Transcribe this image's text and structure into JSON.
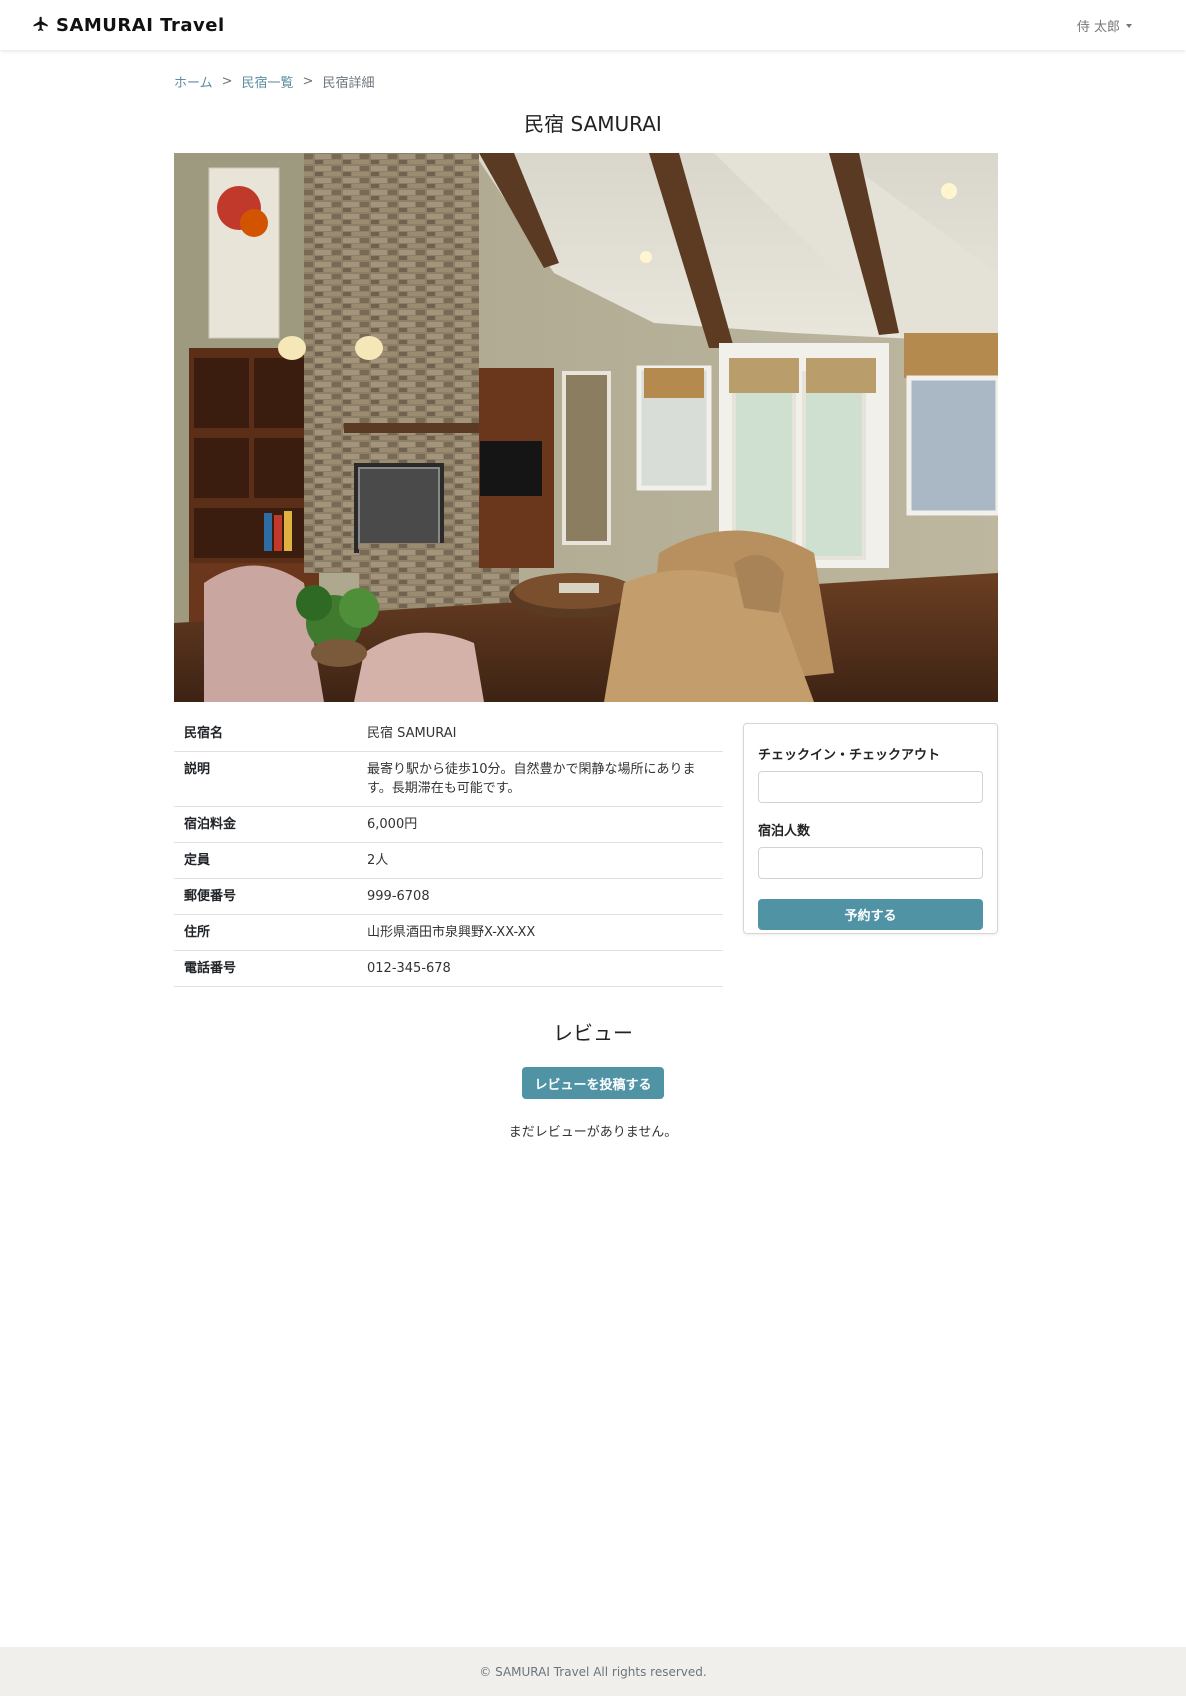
{
  "header": {
    "brand": "SAMURAI Travel",
    "user_name": "侍 太郎"
  },
  "breadcrumb": {
    "home": "ホーム",
    "list": "民宿一覧",
    "current": "民宿詳細",
    "separator": ">"
  },
  "inn": {
    "title": "民宿 SAMURAI",
    "photo_alt": "living room"
  },
  "details": [
    {
      "label": "民宿名",
      "value": "民宿 SAMURAI"
    },
    {
      "label": "説明",
      "value": "最寄り駅から徒歩10分。自然豊かで閑静な場所にあります。長期滞在も可能です。"
    },
    {
      "label": "宿泊料金",
      "value": "6,000円"
    },
    {
      "label": "定員",
      "value": "2人"
    },
    {
      "label": "郵便番号",
      "value": "999-6708"
    },
    {
      "label": "住所",
      "value": "山形県酒田市泉興野X-XX-XX"
    },
    {
      "label": "電話番号",
      "value": "012-345-678"
    }
  ],
  "reservation": {
    "dates_label": "チェックイン・チェックアウト",
    "dates_value": "",
    "guests_label": "宿泊人数",
    "guests_value": "",
    "submit_label": "予約する"
  },
  "reviews": {
    "title": "レビュー",
    "post_button": "レビューを投稿する",
    "empty_message": "まだレビューがありません。"
  },
  "footer": {
    "copyright": "© SAMURAI Travel All rights reserved."
  },
  "colors": {
    "accent": "#5093a5",
    "link": "#5a8ea0",
    "footer_bg": "#f0efeb"
  }
}
